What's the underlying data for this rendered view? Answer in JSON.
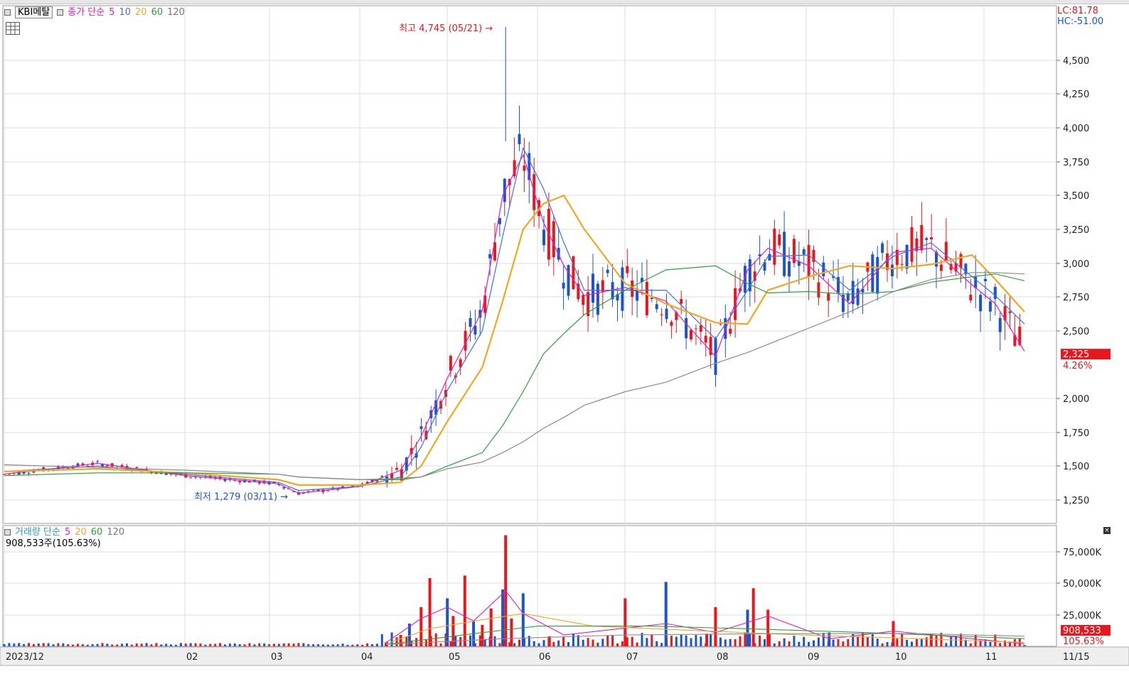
{
  "price_legend": {
    "stock": "KBI메탈",
    "title": "종가 단순",
    "ma_labels": [
      "5",
      "10",
      "20",
      "60",
      "120"
    ]
  },
  "volume_legend": {
    "title": "거래량 단순",
    "ma_labels": [
      "5",
      "20",
      "60",
      "120"
    ],
    "current": "908,533주(105.63%)"
  },
  "indicators": {
    "lc": "LC:81.78",
    "hc": "HC:-51.00"
  },
  "annotations": {
    "high": "최고 4,745 (05/21)",
    "low": "최저 1,279 (03/11)"
  },
  "last_price": {
    "value": "2,325",
    "change": "4.26%"
  },
  "last_volume": {
    "value": "908,533",
    "change": "105.63%"
  },
  "colors": {
    "up": "#e8171d",
    "down": "#1b55c9",
    "ma5": "#e619c9",
    "ma10": "#3e6fe8",
    "ma20": "#f0a820",
    "ma60": "#2aa137",
    "ma120": "#8a8a8a"
  },
  "chart_data": [
    {
      "type": "candlestick",
      "y_ticks": [
        "4,500",
        "4,250",
        "4,000",
        "3,750",
        "3,500",
        "3,250",
        "3,000",
        "2,750",
        "2,500",
        "2,000",
        "1,750",
        "1,500",
        "1,250"
      ],
      "x_ticks": [
        "2023/12",
        "02",
        "03",
        "04",
        "05",
        "06",
        "07",
        "08",
        "09",
        "10",
        "11",
        "11/15"
      ],
      "ylim": [
        1150,
        4850
      ],
      "series": [
        {
          "name": "5",
          "x": [
            "12/01",
            "01/02",
            "02/01",
            "03/04",
            "03/11",
            "04/01",
            "04/15",
            "04/22",
            "05/01",
            "05/13",
            "05/20",
            "05/27",
            "06/03",
            "06/10",
            "06/17",
            "07/01",
            "07/15",
            "08/01",
            "08/12",
            "08/19",
            "09/02",
            "09/16",
            "10/01",
            "10/14",
            "10/28",
            "11/05",
            "11/15"
          ],
          "values": [
            1440,
            1520,
            1430,
            1370,
            1300,
            1350,
            1470,
            1720,
            2150,
            2650,
            3500,
            3800,
            3300,
            2980,
            2760,
            2820,
            2720,
            2310,
            2950,
            3110,
            2980,
            2700,
            3080,
            3110,
            2840,
            2700,
            2350
          ]
        },
        {
          "name": "10",
          "x": [
            "12/01",
            "01/02",
            "02/01",
            "03/04",
            "03/11",
            "04/01",
            "04/15",
            "04/22",
            "05/01",
            "05/13",
            "05/20",
            "05/27",
            "06/03",
            "06/10",
            "06/17",
            "07/01",
            "07/15",
            "08/01",
            "08/12",
            "08/19",
            "09/02",
            "09/16",
            "10/01",
            "10/14",
            "10/28",
            "11/05",
            "11/15"
          ],
          "values": [
            1460,
            1500,
            1440,
            1380,
            1320,
            1350,
            1420,
            1640,
            2060,
            2500,
            3200,
            3850,
            3550,
            3150,
            2800,
            2800,
            2800,
            2440,
            2800,
            3050,
            3060,
            2800,
            3050,
            3150,
            2900,
            2760,
            2550
          ]
        },
        {
          "name": "20",
          "x": [
            "12/01",
            "01/02",
            "02/01",
            "03/04",
            "03/11",
            "04/01",
            "04/15",
            "04/22",
            "05/01",
            "05/13",
            "05/20",
            "05/27",
            "06/03",
            "06/10",
            "06/17",
            "07/01",
            "07/15",
            "08/01",
            "08/12",
            "08/19",
            "09/02",
            "09/16",
            "10/01",
            "10/14",
            "10/28",
            "11/05",
            "11/15"
          ],
          "values": [
            1460,
            1480,
            1450,
            1400,
            1360,
            1360,
            1380,
            1500,
            1830,
            2230,
            2720,
            3250,
            3440,
            3500,
            3250,
            2850,
            2700,
            2560,
            2550,
            2800,
            2900,
            2980,
            2960,
            2990,
            3060,
            2880,
            2640
          ]
        },
        {
          "name": "60",
          "x": [
            "12/01",
            "01/02",
            "02/01",
            "03/04",
            "03/11",
            "04/01",
            "04/15",
            "04/22",
            "05/01",
            "05/13",
            "05/20",
            "05/27",
            "06/03",
            "06/10",
            "06/17",
            "07/01",
            "07/15",
            "08/01",
            "08/12",
            "08/19",
            "09/02",
            "09/16",
            "10/01",
            "10/14",
            "10/28",
            "11/05",
            "11/15"
          ],
          "values": [
            1430,
            1450,
            1450,
            1440,
            1420,
            1400,
            1400,
            1420,
            1500,
            1600,
            1800,
            2050,
            2330,
            2480,
            2620,
            2800,
            2950,
            2980,
            2850,
            2780,
            2790,
            2770,
            2790,
            2860,
            2900,
            2920,
            2870
          ]
        },
        {
          "name": "120",
          "x": [
            "12/01",
            "01/02",
            "02/01",
            "03/04",
            "03/11",
            "04/01",
            "04/15",
            "04/22",
            "05/01",
            "05/13",
            "05/20",
            "05/27",
            "06/03",
            "06/10",
            "06/17",
            "07/01",
            "07/15",
            "08/01",
            "08/12",
            "08/19",
            "09/02",
            "09/16",
            "10/01",
            "10/14",
            "10/28",
            "11/05",
            "11/15"
          ],
          "values": [
            1510,
            1490,
            1470,
            1440,
            1420,
            1400,
            1410,
            1420,
            1480,
            1530,
            1600,
            1680,
            1780,
            1860,
            1950,
            2050,
            2120,
            2260,
            2340,
            2400,
            2520,
            2640,
            2790,
            2880,
            2930,
            2930,
            2920
          ]
        }
      ]
    },
    {
      "type": "bar",
      "y_ticks": [
        "75,000K",
        "50,000K",
        "25,000K"
      ],
      "ylim": [
        0,
        90000
      ],
      "series": [
        {
          "name": "volume",
          "x": [
            "04/10",
            "04/15",
            "04/18",
            "04/22",
            "04/25",
            "05/01",
            "05/03",
            "05/07",
            "05/10",
            "05/13",
            "05/16",
            "05/20",
            "05/21",
            "05/23",
            "05/27",
            "06/05",
            "07/01",
            "07/15",
            "07/29",
            "08/01",
            "08/12",
            "08/14",
            "08/19",
            "09/09",
            "10/01",
            "10/14",
            "11/15"
          ],
          "values": [
            3000,
            9000,
            18000,
            31000,
            54000,
            38000,
            24000,
            56000,
            20000,
            17000,
            30000,
            45000,
            88000,
            22000,
            42000,
            8000,
            38000,
            51000,
            10000,
            31000,
            29000,
            46000,
            29000,
            11000,
            20000,
            10000,
            908
          ]
        }
      ]
    }
  ]
}
